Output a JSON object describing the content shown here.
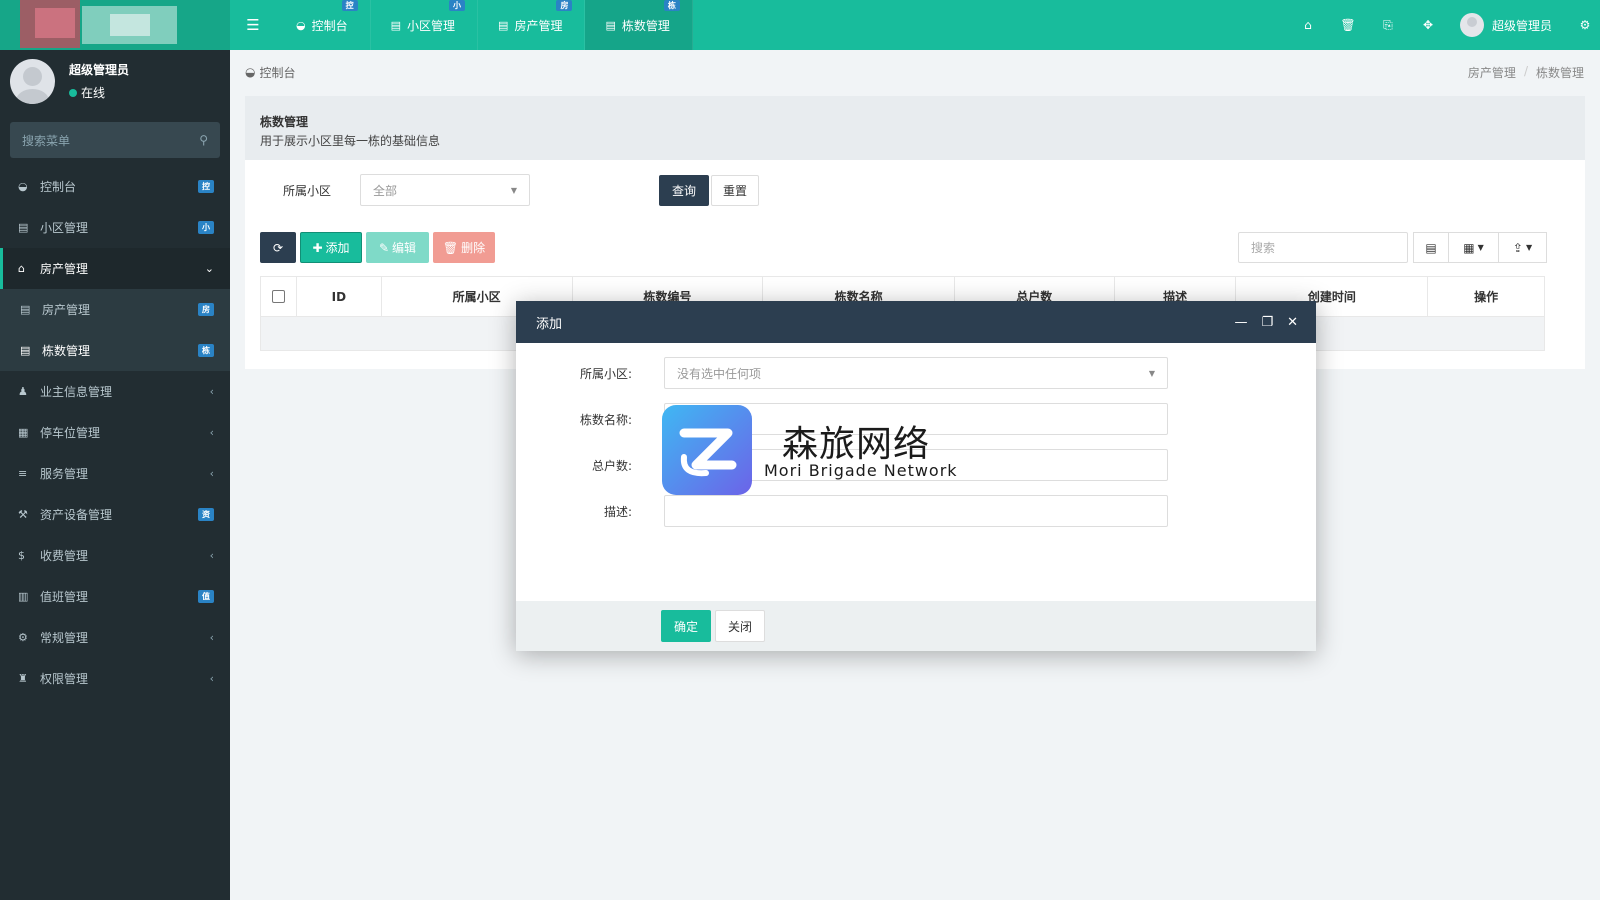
{
  "colors": {
    "primary": "#18bc9c",
    "dark": "#2c3e50",
    "sidebar": "#222d32",
    "danger": "#e74c3c",
    "badge": "#2a83c5"
  },
  "header": {
    "tabs": [
      {
        "label": "控制台",
        "badge": "控",
        "icon": "dashboard-icon"
      },
      {
        "label": "小区管理",
        "badge": "小",
        "icon": "list-icon"
      },
      {
        "label": "房产管理",
        "badge": "房",
        "icon": "list-icon"
      },
      {
        "label": "栋数管理",
        "badge": "栋",
        "icon": "list-icon",
        "active": true
      }
    ],
    "user_name": "超级管理员"
  },
  "sidebar": {
    "user_name": "超级管理员",
    "status": "在线",
    "search_placeholder": "搜索菜单",
    "items": [
      {
        "label": "控制台",
        "badge": "控",
        "icon": "dashboard-icon"
      },
      {
        "label": "小区管理",
        "badge": "小",
        "icon": "list-icon"
      },
      {
        "label": "房产管理",
        "icon": "home-icon",
        "open": true
      },
      {
        "label": "业主信息管理",
        "icon": "user-icon"
      },
      {
        "label": "停车位管理",
        "icon": "film-icon"
      },
      {
        "label": "服务管理",
        "icon": "list-icon"
      },
      {
        "label": "资产设备管理",
        "badge": "资",
        "icon": "gavel-icon"
      },
      {
        "label": "收费管理",
        "icon": "dollar-icon"
      },
      {
        "label": "值班管理",
        "badge": "值",
        "icon": "calendar-icon"
      },
      {
        "label": "常规管理",
        "icon": "cogs-icon"
      },
      {
        "label": "权限管理",
        "icon": "group-icon"
      }
    ],
    "sub_items": [
      {
        "label": "房产管理",
        "badge": "房",
        "icon": "list-icon"
      },
      {
        "label": "栋数管理",
        "badge": "栋",
        "icon": "list-icon",
        "active": true
      }
    ]
  },
  "breadcrumb": {
    "home": "控制台",
    "trail": [
      "房产管理",
      "/",
      "栋数管理"
    ]
  },
  "panel": {
    "title": "栋数管理",
    "description": "用于展示小区里每一栋的基础信息"
  },
  "filter": {
    "label": "所属小区",
    "select_value": "全部",
    "query": "查询",
    "reset": "重置"
  },
  "toolbar": {
    "add": "添加",
    "edit": "编辑",
    "delete": "删除",
    "search_placeholder": "搜索"
  },
  "table": {
    "columns": [
      "ID",
      "所属小区",
      "栋数编号",
      "栋数名称",
      "总户数",
      "描述",
      "创建时间",
      "操作"
    ]
  },
  "modal": {
    "title": "添加",
    "fields": [
      {
        "label": "所属小区:",
        "placeholder": "没有选中任何项"
      },
      {
        "label": "栋数名称:",
        "placeholder": ""
      },
      {
        "label": "总户数:",
        "placeholder": ""
      },
      {
        "label": "描述:",
        "placeholder": ""
      }
    ],
    "ok": "确定",
    "close": "关闭"
  },
  "watermark": {
    "cn": "森旅网络",
    "en": "Mori Brigade Network"
  }
}
